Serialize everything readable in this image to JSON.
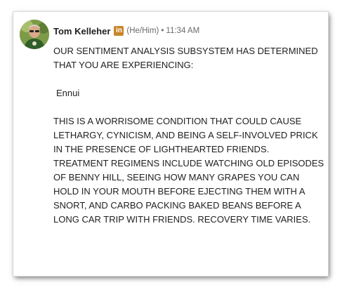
{
  "post": {
    "author": "Tom Kelleher",
    "badge": "in",
    "pronouns": "(He/Him)",
    "separator": "•",
    "time": "11:34 AM",
    "paragraph1": "OUR SENTIMENT ANALYSIS SUBSYSTEM HAS DETERMINED THAT YOU ARE EXPERIENCING:",
    "diagnosis": "Ennui",
    "paragraph2": "THIS IS A WORRISOME CONDITION THAT COULD CAUSE LETHARGY, CYNICISM, AND BEING A SELF-INVOLVED PRICK IN THE PRESENCE OF LIGHTHEARTED FRIENDS. TREATMENT REGIMENS INCLUDE WATCHING OLD EPISODES OF BENNY HILL, SEEING HOW MANY GRAPES YOU CAN HOLD IN YOUR MOUTH BEFORE EJECTING THEM WITH A SNORT, AND CARBO PACKING BAKED BEANS BEFORE A LONG CAR TRIP WITH FRIENDS. RECOVERY TIME VARIES."
  },
  "colors": {
    "badge": "#c7862a",
    "meta_text": "#6b6b6b",
    "body_text": "#1f1f1f"
  }
}
